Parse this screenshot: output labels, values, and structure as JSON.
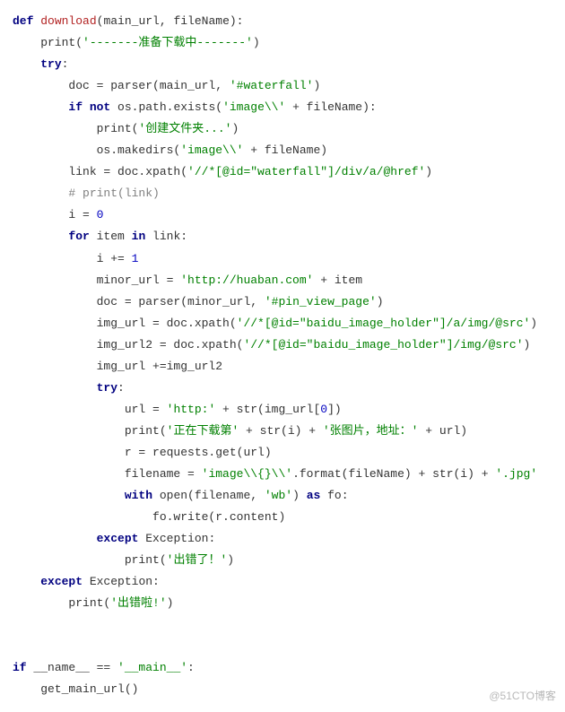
{
  "code": {
    "l1a": "def ",
    "l1b": "download",
    "l1c": "(main_url, fileName):",
    "l2a": "    print(",
    "l2b": "'-------准备下载中-------'",
    "l2c": ")",
    "l3a": "    ",
    "l3b": "try",
    "l3c": ":",
    "l4a": "        doc = parser(main_url, ",
    "l4b": "'#waterfall'",
    "l4c": ")",
    "l5a": "        ",
    "l5b": "if not",
    "l5c": " os.path.exists(",
    "l5d": "'image\\\\'",
    "l5e": " + fileName):",
    "l6a": "            print(",
    "l6b": "'创建文件夹...'",
    "l6c": ")",
    "l7a": "            os.makedirs(",
    "l7b": "'image\\\\'",
    "l7c": " + fileName)",
    "l8a": "        link = doc.xpath(",
    "l8b": "'//*[@id=\"waterfall\"]/div/a/@href'",
    "l8c": ")",
    "l9": "        # print(link)",
    "l10a": "        i = ",
    "l10b": "0",
    "l11a": "        ",
    "l11b": "for",
    "l11c": " item ",
    "l11d": "in",
    "l11e": " link:",
    "l12a": "            i += ",
    "l12b": "1",
    "l13a": "            minor_url = ",
    "l13b": "'http://huaban.com'",
    "l13c": " + item",
    "l14a": "            doc = parser(minor_url, ",
    "l14b": "'#pin_view_page'",
    "l14c": ")",
    "l15a": "            img_url = doc.xpath(",
    "l15b": "'//*[@id=\"baidu_image_holder\"]/a/img/@src'",
    "l15c": ")",
    "l16a": "            img_url2 = doc.xpath(",
    "l16b": "'//*[@id=\"baidu_image_holder\"]/img/@src'",
    "l16c": ")",
    "l17": "            img_url +=img_url2",
    "l18a": "            ",
    "l18b": "try",
    "l18c": ":",
    "l19a": "                url = ",
    "l19b": "'http:'",
    "l19c": " + str(img_url[",
    "l19d": "0",
    "l19e": "])",
    "l20a": "                print(",
    "l20b": "'正在下载第'",
    "l20c": " + str(i) + ",
    "l20d": "'张图片，地址：'",
    "l20e": " + url)",
    "l21": "                r = requests.get(url)",
    "l22a": "                filename = ",
    "l22b": "'image\\\\{}\\\\'",
    "l22c": ".format(fileName) + str(i) + ",
    "l22d": "'.jpg'",
    "l23a": "                ",
    "l23b": "with",
    "l23c": " open(filename, ",
    "l23d": "'wb'",
    "l23e": ") ",
    "l23f": "as",
    "l23g": " fo:",
    "l24": "                    fo.write(r.content)",
    "l25a": "            ",
    "l25b": "except",
    "l25c": " Exception:",
    "l26a": "                print(",
    "l26b": "'出错了！'",
    "l26c": ")",
    "l27a": "    ",
    "l27b": "except",
    "l27c": " Exception:",
    "l28a": "        print(",
    "l28b": "'出错啦!'",
    "l28c": ")",
    "l29": "",
    "l30": "",
    "l31a": "if",
    "l31b": " __name__ == ",
    "l31c": "'__main__'",
    "l31d": ":",
    "l32": "    get_main_url()"
  },
  "watermark": "@51CTO博客"
}
